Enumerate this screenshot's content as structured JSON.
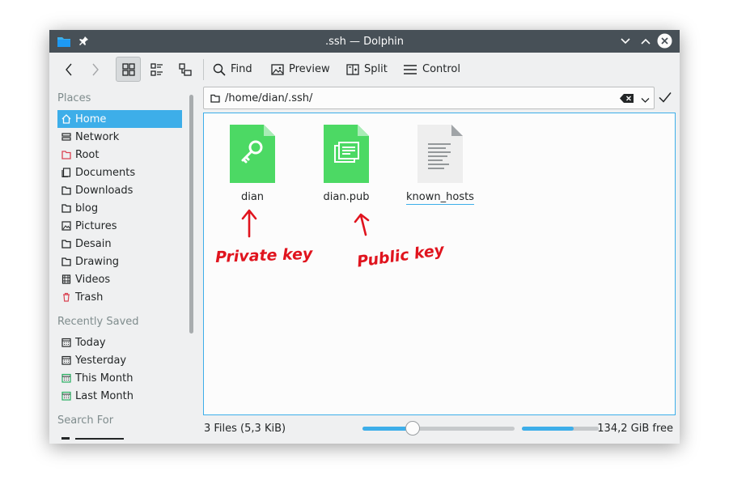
{
  "window": {
    "title": ".ssh — Dolphin"
  },
  "toolbar": {
    "find_label": "Find",
    "preview_label": "Preview",
    "split_label": "Split",
    "control_label": "Control"
  },
  "sidebar": {
    "places_header": "Places",
    "places": [
      {
        "label": "Home",
        "icon": "home-icon",
        "selected": true
      },
      {
        "label": "Network",
        "icon": "network-icon"
      },
      {
        "label": "Root",
        "icon": "root-folder-icon"
      },
      {
        "label": "Documents",
        "icon": "documents-icon"
      },
      {
        "label": "Downloads",
        "icon": "downloads-folder-icon"
      },
      {
        "label": "blog",
        "icon": "folder-icon"
      },
      {
        "label": "Pictures",
        "icon": "pictures-icon"
      },
      {
        "label": "Desain",
        "icon": "folder-icon"
      },
      {
        "label": "Drawing",
        "icon": "folder-icon"
      },
      {
        "label": "Videos",
        "icon": "videos-icon"
      },
      {
        "label": "Trash",
        "icon": "trash-icon"
      }
    ],
    "recent_header": "Recently Saved",
    "recent": [
      {
        "label": "Today",
        "icon": "calendar-icon"
      },
      {
        "label": "Yesterday",
        "icon": "calendar-icon"
      },
      {
        "label": "This Month",
        "icon": "calendar-icon"
      },
      {
        "label": "Last Month",
        "icon": "calendar-icon"
      }
    ],
    "search_header": "Search For"
  },
  "location": {
    "path": "/home/dian/.ssh/"
  },
  "files": [
    {
      "name": "dian",
      "type": "private-key",
      "color": "#4cd964"
    },
    {
      "name": "dian.pub",
      "type": "public-key",
      "color": "#4cd964"
    },
    {
      "name": "known_hosts",
      "type": "text"
    }
  ],
  "annotations": {
    "private": "Private key",
    "public": "Public key"
  },
  "status": {
    "summary": "3 Files (5,3 KiB)",
    "zoom_fraction": 0.33,
    "used_fraction": 0.67,
    "free": "134,2 GiB free"
  },
  "colors": {
    "accent": "#3daee9",
    "titlebar": "#475057",
    "annotation": "#e0141e",
    "trash": "#da4453"
  }
}
